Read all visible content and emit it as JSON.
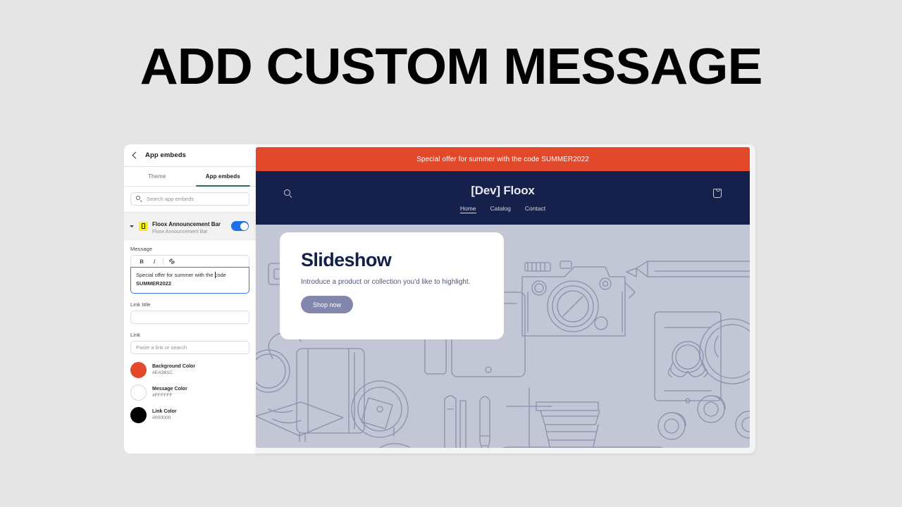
{
  "headline": "ADD CUSTOM MESSAGE",
  "panel": {
    "header_title": "App embeds",
    "back_icon": "chevron-left-icon",
    "tabs": [
      {
        "label": "Theme",
        "active": false
      },
      {
        "label": "App embeds",
        "active": true
      }
    ],
    "search": {
      "placeholder": "Search app embeds",
      "value": "",
      "icon": "search-icon"
    },
    "embed": {
      "name": "Floox Announcement Bar",
      "subtitle": "Floox Announcement Bar",
      "caret_icon": "caret-down-icon",
      "app_icon": "announcement-bar-icon",
      "toggle_on": true,
      "toggle_color": "#1F6FE5"
    },
    "fields": {
      "message_label": "Message",
      "message_toolbar": [
        "B",
        "I",
        "link-icon"
      ],
      "message_text_plain": "Special offer for summer with the ",
      "message_text_bold": "SUMMER2022",
      "message_text_middle": "code ",
      "link_title_label": "Link title",
      "link_title_value": "",
      "link_label": "Link",
      "link_placeholder": "Paste a link or search"
    },
    "colors": [
      {
        "name": "Background Color",
        "hex": "#EA381C",
        "swatch": "#E2492A"
      },
      {
        "name": "Message Color",
        "hex": "#FFFFFF",
        "swatch": "#FFFFFF"
      },
      {
        "name": "Link Color",
        "hex": "#000000",
        "swatch": "#000000"
      }
    ]
  },
  "preview": {
    "announcement": {
      "text": "Special offer for summer with the code SUMMER2022",
      "background": "#E2492A",
      "color": "#FFFFFF"
    },
    "store": {
      "title": "[Dev] Floox",
      "header_bg": "#15204B",
      "search_icon": "search-icon",
      "cart_icon": "shopping-bag-icon",
      "nav": [
        {
          "label": "Home",
          "current": true
        },
        {
          "label": "Catalog",
          "current": false
        },
        {
          "label": "Contact",
          "current": false
        }
      ]
    },
    "slide": {
      "title": "Slideshow",
      "subtitle": "Introduce a product or collection you'd like to highlight.",
      "button_label": "Shop now",
      "button_color": "#8188AB"
    },
    "hero_bg": "#C3C6D4"
  }
}
